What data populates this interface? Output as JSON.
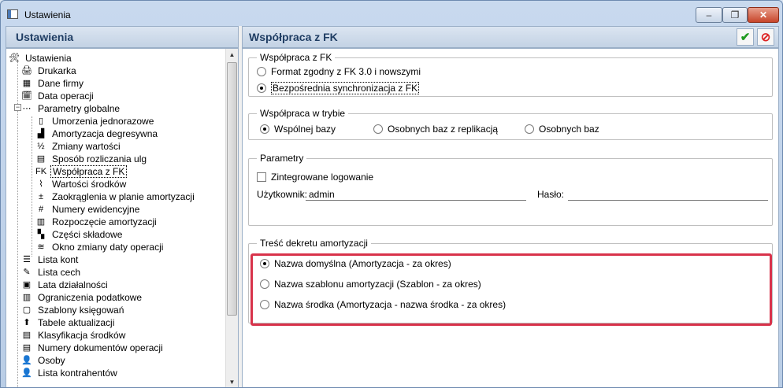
{
  "window": {
    "title": "Ustawienia",
    "minimize_label": "–",
    "maximize_label": "❐",
    "close_label": "✕"
  },
  "left_panel": {
    "title": "Ustawienia",
    "tree": [
      {
        "label": "Ustawienia",
        "icon": "tools-icon",
        "glyph": "🛠"
      },
      {
        "label": "Drukarka",
        "icon": "printer-icon",
        "glyph": "🖨"
      },
      {
        "label": "Dane firmy",
        "icon": "company-icon",
        "glyph": "▦"
      },
      {
        "label": "Data operacji",
        "icon": "calendar-icon",
        "glyph": "🗓"
      },
      {
        "label": "Parametry globalne",
        "icon": "settings-dots-icon",
        "glyph": "⋯"
      },
      {
        "label": "Umorzenia jednorazowe",
        "icon": "depreciation-icon",
        "glyph": "▯"
      },
      {
        "label": "Amortyzacja degresywna",
        "icon": "chart-icon",
        "glyph": "▟"
      },
      {
        "label": "Zmiany wartości",
        "icon": "value-change-icon",
        "glyph": "½"
      },
      {
        "label": "Sposób rozliczania ulg",
        "icon": "relief-icon",
        "glyph": "▤"
      },
      {
        "label": "Współpraca z FK",
        "icon": "fk-icon",
        "glyph": "FK"
      },
      {
        "label": "Wartości środków",
        "icon": "tape-icon",
        "glyph": "⌇"
      },
      {
        "label": "Zaokrąglenia w planie amortyzacji",
        "icon": "rounding-icon",
        "glyph": "±"
      },
      {
        "label": "Numery ewidencyjne",
        "icon": "numbers-icon",
        "glyph": "#"
      },
      {
        "label": "Rozpoczęcie amortyzacji",
        "icon": "start-icon",
        "glyph": "▥"
      },
      {
        "label": "Części składowe",
        "icon": "parts-icon",
        "glyph": "▚"
      },
      {
        "label": "Okno zmiany daty operacji",
        "icon": "stack-icon",
        "glyph": "≋"
      },
      {
        "label": "Lista kont",
        "icon": "accounts-icon",
        "glyph": "☰"
      },
      {
        "label": "Lista cech",
        "icon": "features-icon",
        "glyph": "✎"
      },
      {
        "label": "Lata działalności",
        "icon": "years-icon",
        "glyph": "▣"
      },
      {
        "label": "Ograniczenia podatkowe",
        "icon": "tax-icon",
        "glyph": "▥"
      },
      {
        "label": "Szablony księgowań",
        "icon": "templates-icon",
        "glyph": "▢"
      },
      {
        "label": "Tabele aktualizacji",
        "icon": "update-icon",
        "glyph": "⬆"
      },
      {
        "label": "Klasyfikacja środków",
        "icon": "classification-icon",
        "glyph": "▤"
      },
      {
        "label": "Numery dokumentów operacji",
        "icon": "documents-icon",
        "glyph": "▤"
      },
      {
        "label": "Osoby",
        "icon": "person-icon",
        "glyph": "👤"
      },
      {
        "label": "Lista kontrahentów",
        "icon": "contractors-icon",
        "glyph": "👤"
      }
    ]
  },
  "right_panel": {
    "title": "Współpraca z FK",
    "ok_label": "✔",
    "cancel_label": "⊘",
    "group_fk": {
      "legend": "Współpraca z FK",
      "options": [
        "Format zgodny z FK 3.0 i nowszymi",
        "Bezpośrednia synchronizacja z FK"
      ],
      "selected": 1
    },
    "group_mode": {
      "legend": "Współpraca w trybie",
      "options": [
        "Wspólnej bazy",
        "Osobnych baz z replikacją",
        "Osobnych baz"
      ],
      "selected": 0
    },
    "group_params": {
      "legend": "Parametry",
      "checkbox_label": "Zintegrowane logowanie",
      "checked": false,
      "user_label": "Użytkownik:",
      "user_value": "admin",
      "password_label": "Hasło:",
      "password_value": ""
    },
    "group_decree": {
      "legend": "Treść dekretu amortyzacji",
      "options": [
        "Nazwa domyślna (Amortyzacja - za okres)",
        "Nazwa szablonu amortyzacji (Szablon - za okres)",
        "Nazwa środka (Amortyzacja - nazwa środka - za okres)"
      ],
      "selected": 0
    }
  },
  "colors": {
    "highlight": "#d8324a",
    "header_text": "#1f3d63"
  }
}
